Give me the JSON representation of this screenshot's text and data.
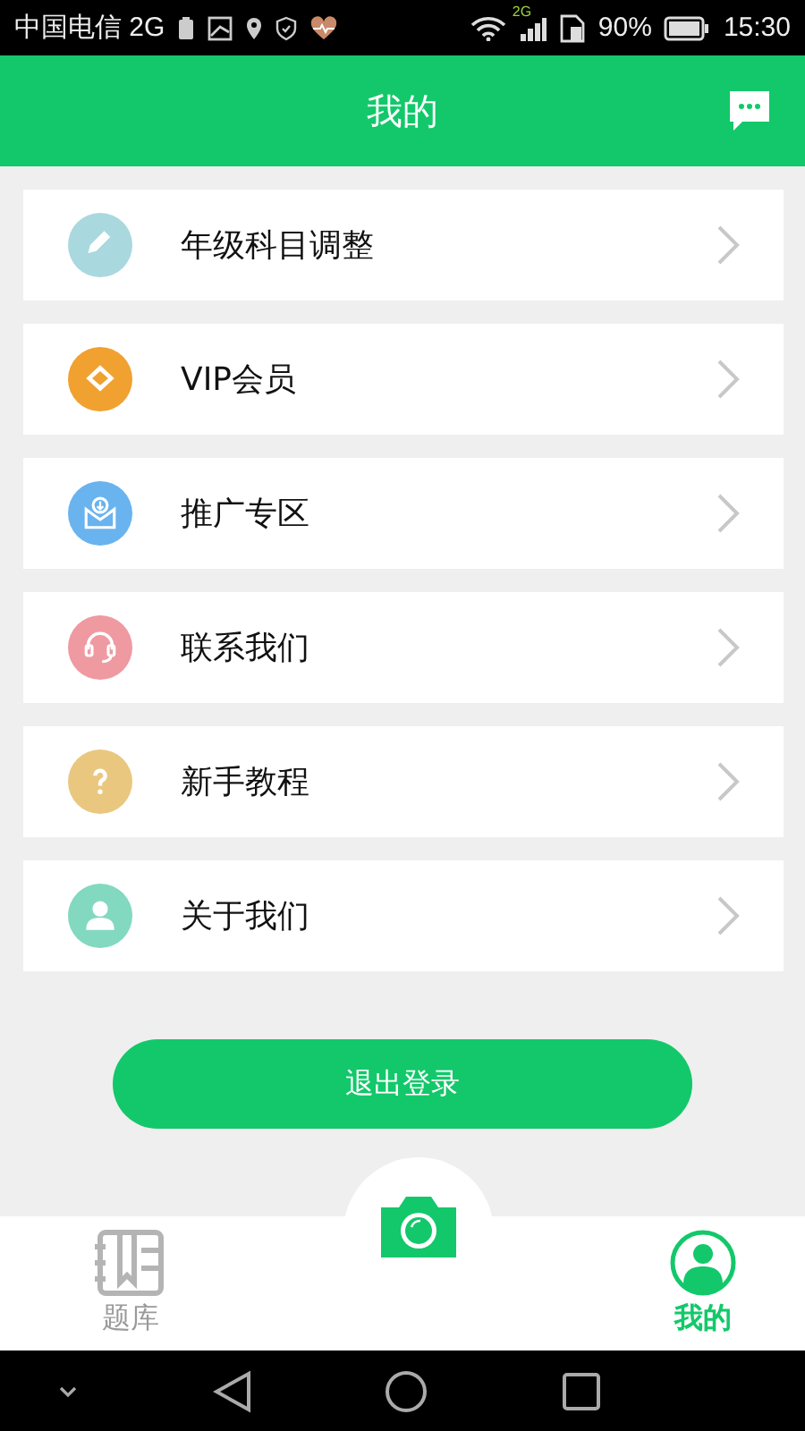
{
  "status_bar": {
    "carrier": "中国电信 2G",
    "network": "2G",
    "battery": "90%",
    "time": "15:30"
  },
  "header": {
    "title": "我的"
  },
  "menu": [
    {
      "label": "年级科目调整",
      "kind": "pencil",
      "color": "#a9d8df"
    },
    {
      "label": "VIP会员",
      "kind": "diamond",
      "color": "#f0a12f"
    },
    {
      "label": "推广专区",
      "kind": "download",
      "color": "#69b3ef"
    },
    {
      "label": "联系我们",
      "kind": "headset",
      "color": "#ef99a1"
    },
    {
      "label": "新手教程",
      "kind": "question",
      "color": "#eac77f"
    },
    {
      "label": "关于我们",
      "kind": "person",
      "color": "#82d9c0"
    }
  ],
  "logout_button": "退出登录",
  "tabs": [
    {
      "kind": "book",
      "label": "题库",
      "selected": false
    },
    {
      "kind": "camera",
      "selected": false
    },
    {
      "kind": "profile",
      "label": "我的",
      "selected": true
    }
  ]
}
